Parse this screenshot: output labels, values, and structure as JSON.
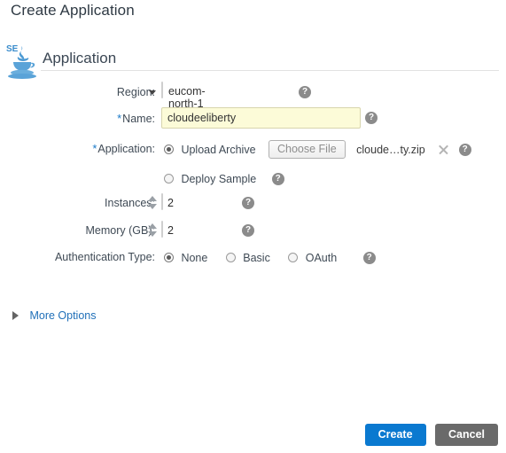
{
  "page": {
    "title": "Create Application"
  },
  "section": {
    "logo_icon": "java-se-logo-icon",
    "logo_text": "SE",
    "title": "Application"
  },
  "form": {
    "region": {
      "label": "Region:",
      "value": "eucom-north-1",
      "caret_icon": "chevron-down-icon",
      "help_icon": "help-icon",
      "help_glyph": "?"
    },
    "name": {
      "required_marker": "*",
      "label": "Name:",
      "value": "cloudeeliberty",
      "placeholder": "",
      "help_icon": "help-icon",
      "help_glyph": "?"
    },
    "application": {
      "required_marker": "*",
      "label": "Application:",
      "upload_option": "Upload Archive",
      "choose_file_button": "Choose File",
      "file_name": "cloude…ty.zip",
      "clear_icon": "clear-x-icon",
      "help_glyph": "?",
      "sample_option": "Deploy Sample",
      "selected": "Upload Archive"
    },
    "instances": {
      "label": "Instances:",
      "value": "2",
      "help_glyph": "?"
    },
    "memory": {
      "label": "Memory (GB):",
      "value": "2",
      "help_glyph": "?"
    },
    "auth": {
      "label": "Authentication Type:",
      "options": [
        "None",
        "Basic",
        "OAuth"
      ],
      "selected": "None",
      "help_glyph": "?"
    }
  },
  "more_options": {
    "label": "More Options",
    "expand_icon": "triangle-right-icon",
    "expanded": false
  },
  "footer": {
    "create_label": "Create",
    "cancel_label": "Cancel"
  },
  "colors": {
    "accent_blue": "#0a79d0",
    "link_blue": "#1f6fb8",
    "required_blue": "#1878c7",
    "cancel_gray": "#6a6a6a",
    "input_highlight": "#fcfbd8",
    "help_gray": "#8b8b8b"
  }
}
